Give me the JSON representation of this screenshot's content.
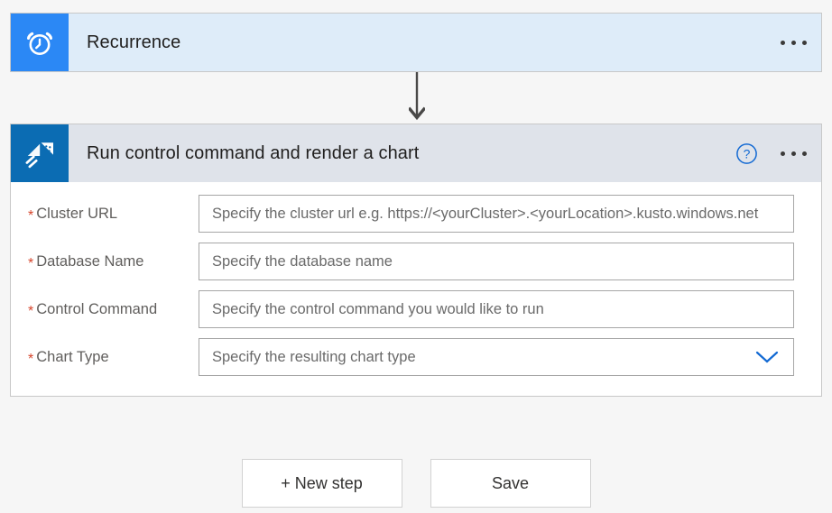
{
  "canvas": {
    "background_color": "#f6f6f6"
  },
  "steps": [
    {
      "id": "recurrence",
      "title": "Recurrence",
      "icon": "alarm-clock-icon",
      "icon_background": "#2b88f5",
      "header_background": "#deecf9",
      "has_help": false,
      "overflow_label": "More commands"
    },
    {
      "id": "kusto-run-control-command",
      "title": "Run control command and render a chart",
      "icon": "kusto-kite-icon",
      "icon_background": "#0b6cb3",
      "header_background": "#dfe3ea",
      "has_help": true,
      "help_label": "Help",
      "overflow_label": "More commands"
    }
  ],
  "connector": {
    "type": "arrow-down",
    "color": "#494847"
  },
  "form": {
    "required_marker": "*",
    "required_marker_color": "#d6452c",
    "fields": [
      {
        "name": "cluster-url",
        "label": "Cluster URL",
        "placeholder": "Specify the cluster url e.g. https://<yourCluster>.<yourLocation>.kusto.windows.net",
        "value": "",
        "required": true,
        "control": "text"
      },
      {
        "name": "database-name",
        "label": "Database Name",
        "placeholder": "Specify the database name",
        "value": "",
        "required": true,
        "control": "text"
      },
      {
        "name": "control-command",
        "label": "Control Command",
        "placeholder": "Specify the control command you would like to run",
        "value": "",
        "required": true,
        "control": "text"
      },
      {
        "name": "chart-type",
        "label": "Chart Type",
        "placeholder": "Specify the resulting chart type",
        "value": "",
        "required": true,
        "control": "dropdown",
        "chevron_color": "#1269d3"
      }
    ]
  },
  "footer": {
    "new_step_label": "+ New step",
    "save_label": "Save"
  }
}
